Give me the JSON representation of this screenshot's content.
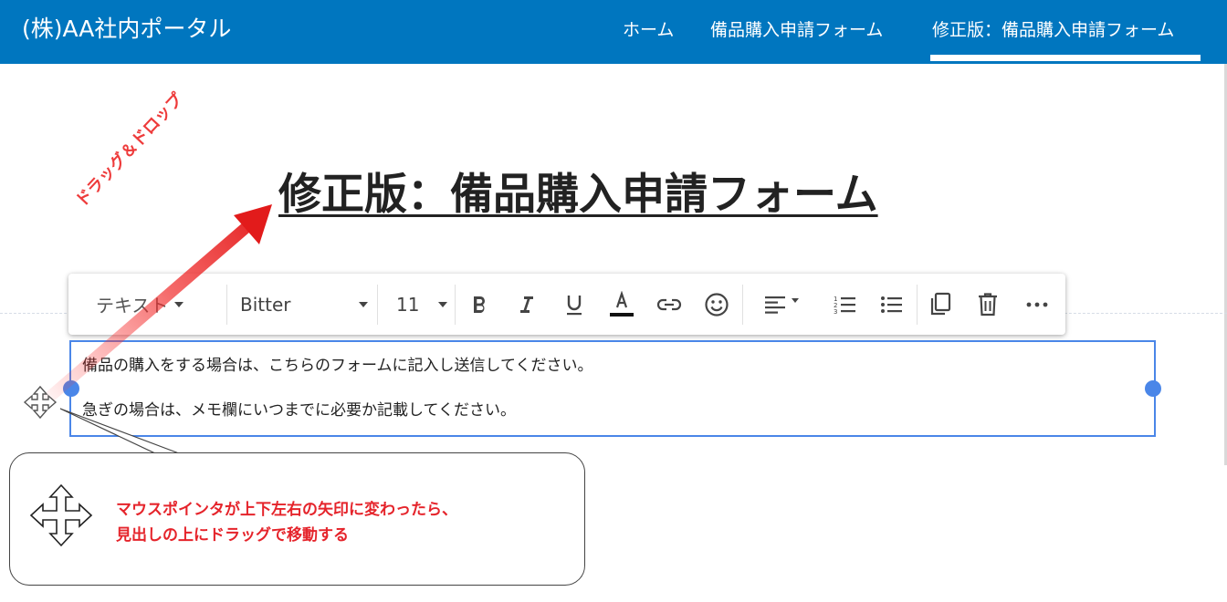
{
  "header": {
    "site_title": "(株)AA社内ポータル",
    "nav": [
      {
        "label": "ホーム"
      },
      {
        "label": "備品購入申請フォーム"
      },
      {
        "label": "修正版：備品購入申請フォーム"
      }
    ]
  },
  "page": {
    "title": "修正版：備品購入申請フォーム"
  },
  "toolbar": {
    "block_type": "テキスト",
    "font_family": "Bitter",
    "font_size": "11"
  },
  "text_block": {
    "paragraph1": "備品の購入をする場合は、こちらのフォームに記入し送信してください。",
    "paragraph2": "急ぎの場合は、メモ欄にいつまでに必要か記載してください。"
  },
  "annotations": {
    "drag_label": "ドラッグ＆ドロップ",
    "callout_line1": "マウスポインタが上下左右の矢印に変わったら、",
    "callout_line2": "見出しの上にドラッグで移動する"
  },
  "colors": {
    "header_bg": "#0076bf",
    "accent_blue": "#4a86e8",
    "annotation_red": "#e5242b"
  }
}
